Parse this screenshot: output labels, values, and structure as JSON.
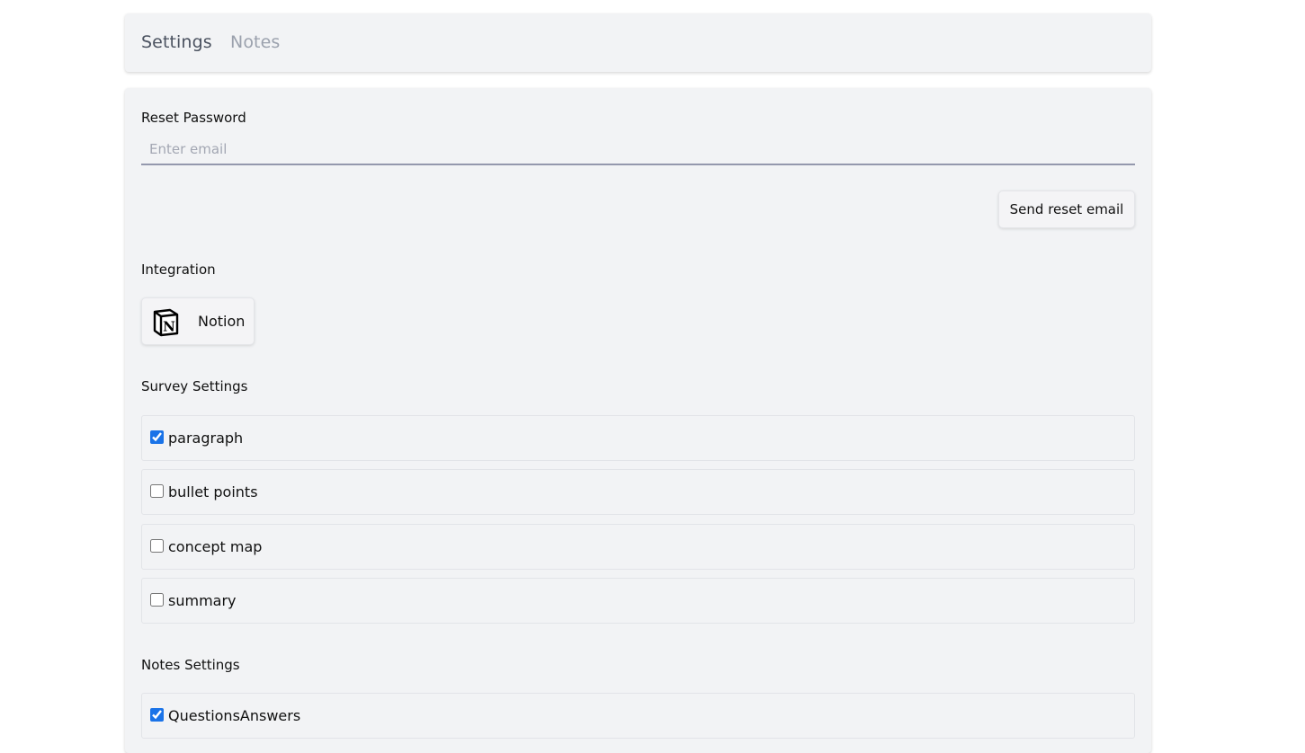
{
  "tabs": [
    {
      "label": "Settings",
      "active": true
    },
    {
      "label": "Notes",
      "active": false
    }
  ],
  "reset_password": {
    "label": "Reset Password",
    "email_placeholder": "Enter email",
    "email_value": "",
    "button_label": "Send reset email"
  },
  "integration": {
    "label": "Integration",
    "notion": {
      "label": "Notion",
      "icon": "notion-icon"
    }
  },
  "survey_settings": {
    "label": "Survey Settings",
    "options": [
      {
        "label": "paragraph",
        "checked": true
      },
      {
        "label": "bullet points",
        "checked": false
      },
      {
        "label": "concept map",
        "checked": false
      },
      {
        "label": "summary",
        "checked": false
      }
    ]
  },
  "notes_settings": {
    "label": "Notes Settings",
    "options": [
      {
        "label": "QuestionsAnswers",
        "checked": true
      }
    ]
  },
  "colors": {
    "card_background": "#f2f3f5",
    "checkbox_accent": "#1a73e8",
    "input_underline": "#9498ad",
    "tab_inactive": "#9ba1ad"
  }
}
